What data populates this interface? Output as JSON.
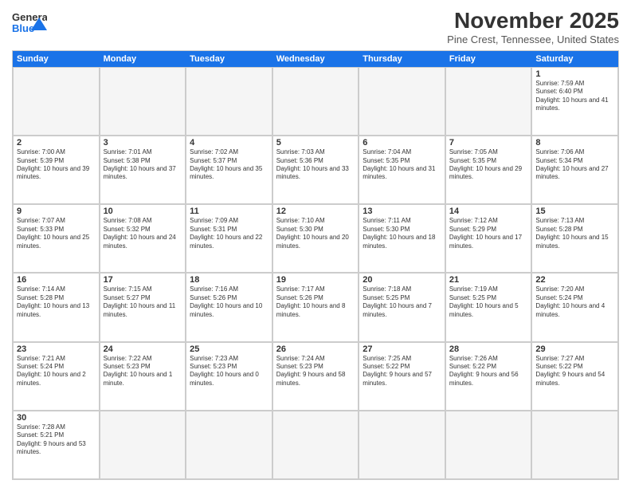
{
  "header": {
    "logo_line1": "General",
    "logo_line2": "Blue",
    "month": "November 2025",
    "location": "Pine Crest, Tennessee, United States"
  },
  "days_of_week": [
    "Sunday",
    "Monday",
    "Tuesday",
    "Wednesday",
    "Thursday",
    "Friday",
    "Saturday"
  ],
  "cells": [
    {
      "day": "",
      "empty": true,
      "text": ""
    },
    {
      "day": "",
      "empty": true,
      "text": ""
    },
    {
      "day": "",
      "empty": true,
      "text": ""
    },
    {
      "day": "",
      "empty": true,
      "text": ""
    },
    {
      "day": "",
      "empty": true,
      "text": ""
    },
    {
      "day": "",
      "empty": true,
      "text": ""
    },
    {
      "day": "1",
      "empty": false,
      "text": "Sunrise: 7:59 AM\nSunset: 6:40 PM\nDaylight: 10 hours and 41 minutes."
    },
    {
      "day": "2",
      "empty": false,
      "text": "Sunrise: 7:00 AM\nSunset: 5:39 PM\nDaylight: 10 hours and 39 minutes."
    },
    {
      "day": "3",
      "empty": false,
      "text": "Sunrise: 7:01 AM\nSunset: 5:38 PM\nDaylight: 10 hours and 37 minutes."
    },
    {
      "day": "4",
      "empty": false,
      "text": "Sunrise: 7:02 AM\nSunset: 5:37 PM\nDaylight: 10 hours and 35 minutes."
    },
    {
      "day": "5",
      "empty": false,
      "text": "Sunrise: 7:03 AM\nSunset: 5:36 PM\nDaylight: 10 hours and 33 minutes."
    },
    {
      "day": "6",
      "empty": false,
      "text": "Sunrise: 7:04 AM\nSunset: 5:35 PM\nDaylight: 10 hours and 31 minutes."
    },
    {
      "day": "7",
      "empty": false,
      "text": "Sunrise: 7:05 AM\nSunset: 5:35 PM\nDaylight: 10 hours and 29 minutes."
    },
    {
      "day": "8",
      "empty": false,
      "text": "Sunrise: 7:06 AM\nSunset: 5:34 PM\nDaylight: 10 hours and 27 minutes."
    },
    {
      "day": "9",
      "empty": false,
      "text": "Sunrise: 7:07 AM\nSunset: 5:33 PM\nDaylight: 10 hours and 25 minutes."
    },
    {
      "day": "10",
      "empty": false,
      "text": "Sunrise: 7:08 AM\nSunset: 5:32 PM\nDaylight: 10 hours and 24 minutes."
    },
    {
      "day": "11",
      "empty": false,
      "text": "Sunrise: 7:09 AM\nSunset: 5:31 PM\nDaylight: 10 hours and 22 minutes."
    },
    {
      "day": "12",
      "empty": false,
      "text": "Sunrise: 7:10 AM\nSunset: 5:30 PM\nDaylight: 10 hours and 20 minutes."
    },
    {
      "day": "13",
      "empty": false,
      "text": "Sunrise: 7:11 AM\nSunset: 5:30 PM\nDaylight: 10 hours and 18 minutes."
    },
    {
      "day": "14",
      "empty": false,
      "text": "Sunrise: 7:12 AM\nSunset: 5:29 PM\nDaylight: 10 hours and 17 minutes."
    },
    {
      "day": "15",
      "empty": false,
      "text": "Sunrise: 7:13 AM\nSunset: 5:28 PM\nDaylight: 10 hours and 15 minutes."
    },
    {
      "day": "16",
      "empty": false,
      "text": "Sunrise: 7:14 AM\nSunset: 5:28 PM\nDaylight: 10 hours and 13 minutes."
    },
    {
      "day": "17",
      "empty": false,
      "text": "Sunrise: 7:15 AM\nSunset: 5:27 PM\nDaylight: 10 hours and 11 minutes."
    },
    {
      "day": "18",
      "empty": false,
      "text": "Sunrise: 7:16 AM\nSunset: 5:26 PM\nDaylight: 10 hours and 10 minutes."
    },
    {
      "day": "19",
      "empty": false,
      "text": "Sunrise: 7:17 AM\nSunset: 5:26 PM\nDaylight: 10 hours and 8 minutes."
    },
    {
      "day": "20",
      "empty": false,
      "text": "Sunrise: 7:18 AM\nSunset: 5:25 PM\nDaylight: 10 hours and 7 minutes."
    },
    {
      "day": "21",
      "empty": false,
      "text": "Sunrise: 7:19 AM\nSunset: 5:25 PM\nDaylight: 10 hours and 5 minutes."
    },
    {
      "day": "22",
      "empty": false,
      "text": "Sunrise: 7:20 AM\nSunset: 5:24 PM\nDaylight: 10 hours and 4 minutes."
    },
    {
      "day": "23",
      "empty": false,
      "text": "Sunrise: 7:21 AM\nSunset: 5:24 PM\nDaylight: 10 hours and 2 minutes."
    },
    {
      "day": "24",
      "empty": false,
      "text": "Sunrise: 7:22 AM\nSunset: 5:23 PM\nDaylight: 10 hours and 1 minute."
    },
    {
      "day": "25",
      "empty": false,
      "text": "Sunrise: 7:23 AM\nSunset: 5:23 PM\nDaylight: 10 hours and 0 minutes."
    },
    {
      "day": "26",
      "empty": false,
      "text": "Sunrise: 7:24 AM\nSunset: 5:23 PM\nDaylight: 9 hours and 58 minutes."
    },
    {
      "day": "27",
      "empty": false,
      "text": "Sunrise: 7:25 AM\nSunset: 5:22 PM\nDaylight: 9 hours and 57 minutes."
    },
    {
      "day": "28",
      "empty": false,
      "text": "Sunrise: 7:26 AM\nSunset: 5:22 PM\nDaylight: 9 hours and 56 minutes."
    },
    {
      "day": "29",
      "empty": false,
      "text": "Sunrise: 7:27 AM\nSunset: 5:22 PM\nDaylight: 9 hours and 54 minutes."
    },
    {
      "day": "30",
      "empty": false,
      "text": "Sunrise: 7:28 AM\nSunset: 5:21 PM\nDaylight: 9 hours and 53 minutes."
    },
    {
      "day": "",
      "empty": true,
      "text": ""
    },
    {
      "day": "",
      "empty": true,
      "text": ""
    },
    {
      "day": "",
      "empty": true,
      "text": ""
    },
    {
      "day": "",
      "empty": true,
      "text": ""
    },
    {
      "day": "",
      "empty": true,
      "text": ""
    },
    {
      "day": "",
      "empty": true,
      "text": ""
    }
  ]
}
